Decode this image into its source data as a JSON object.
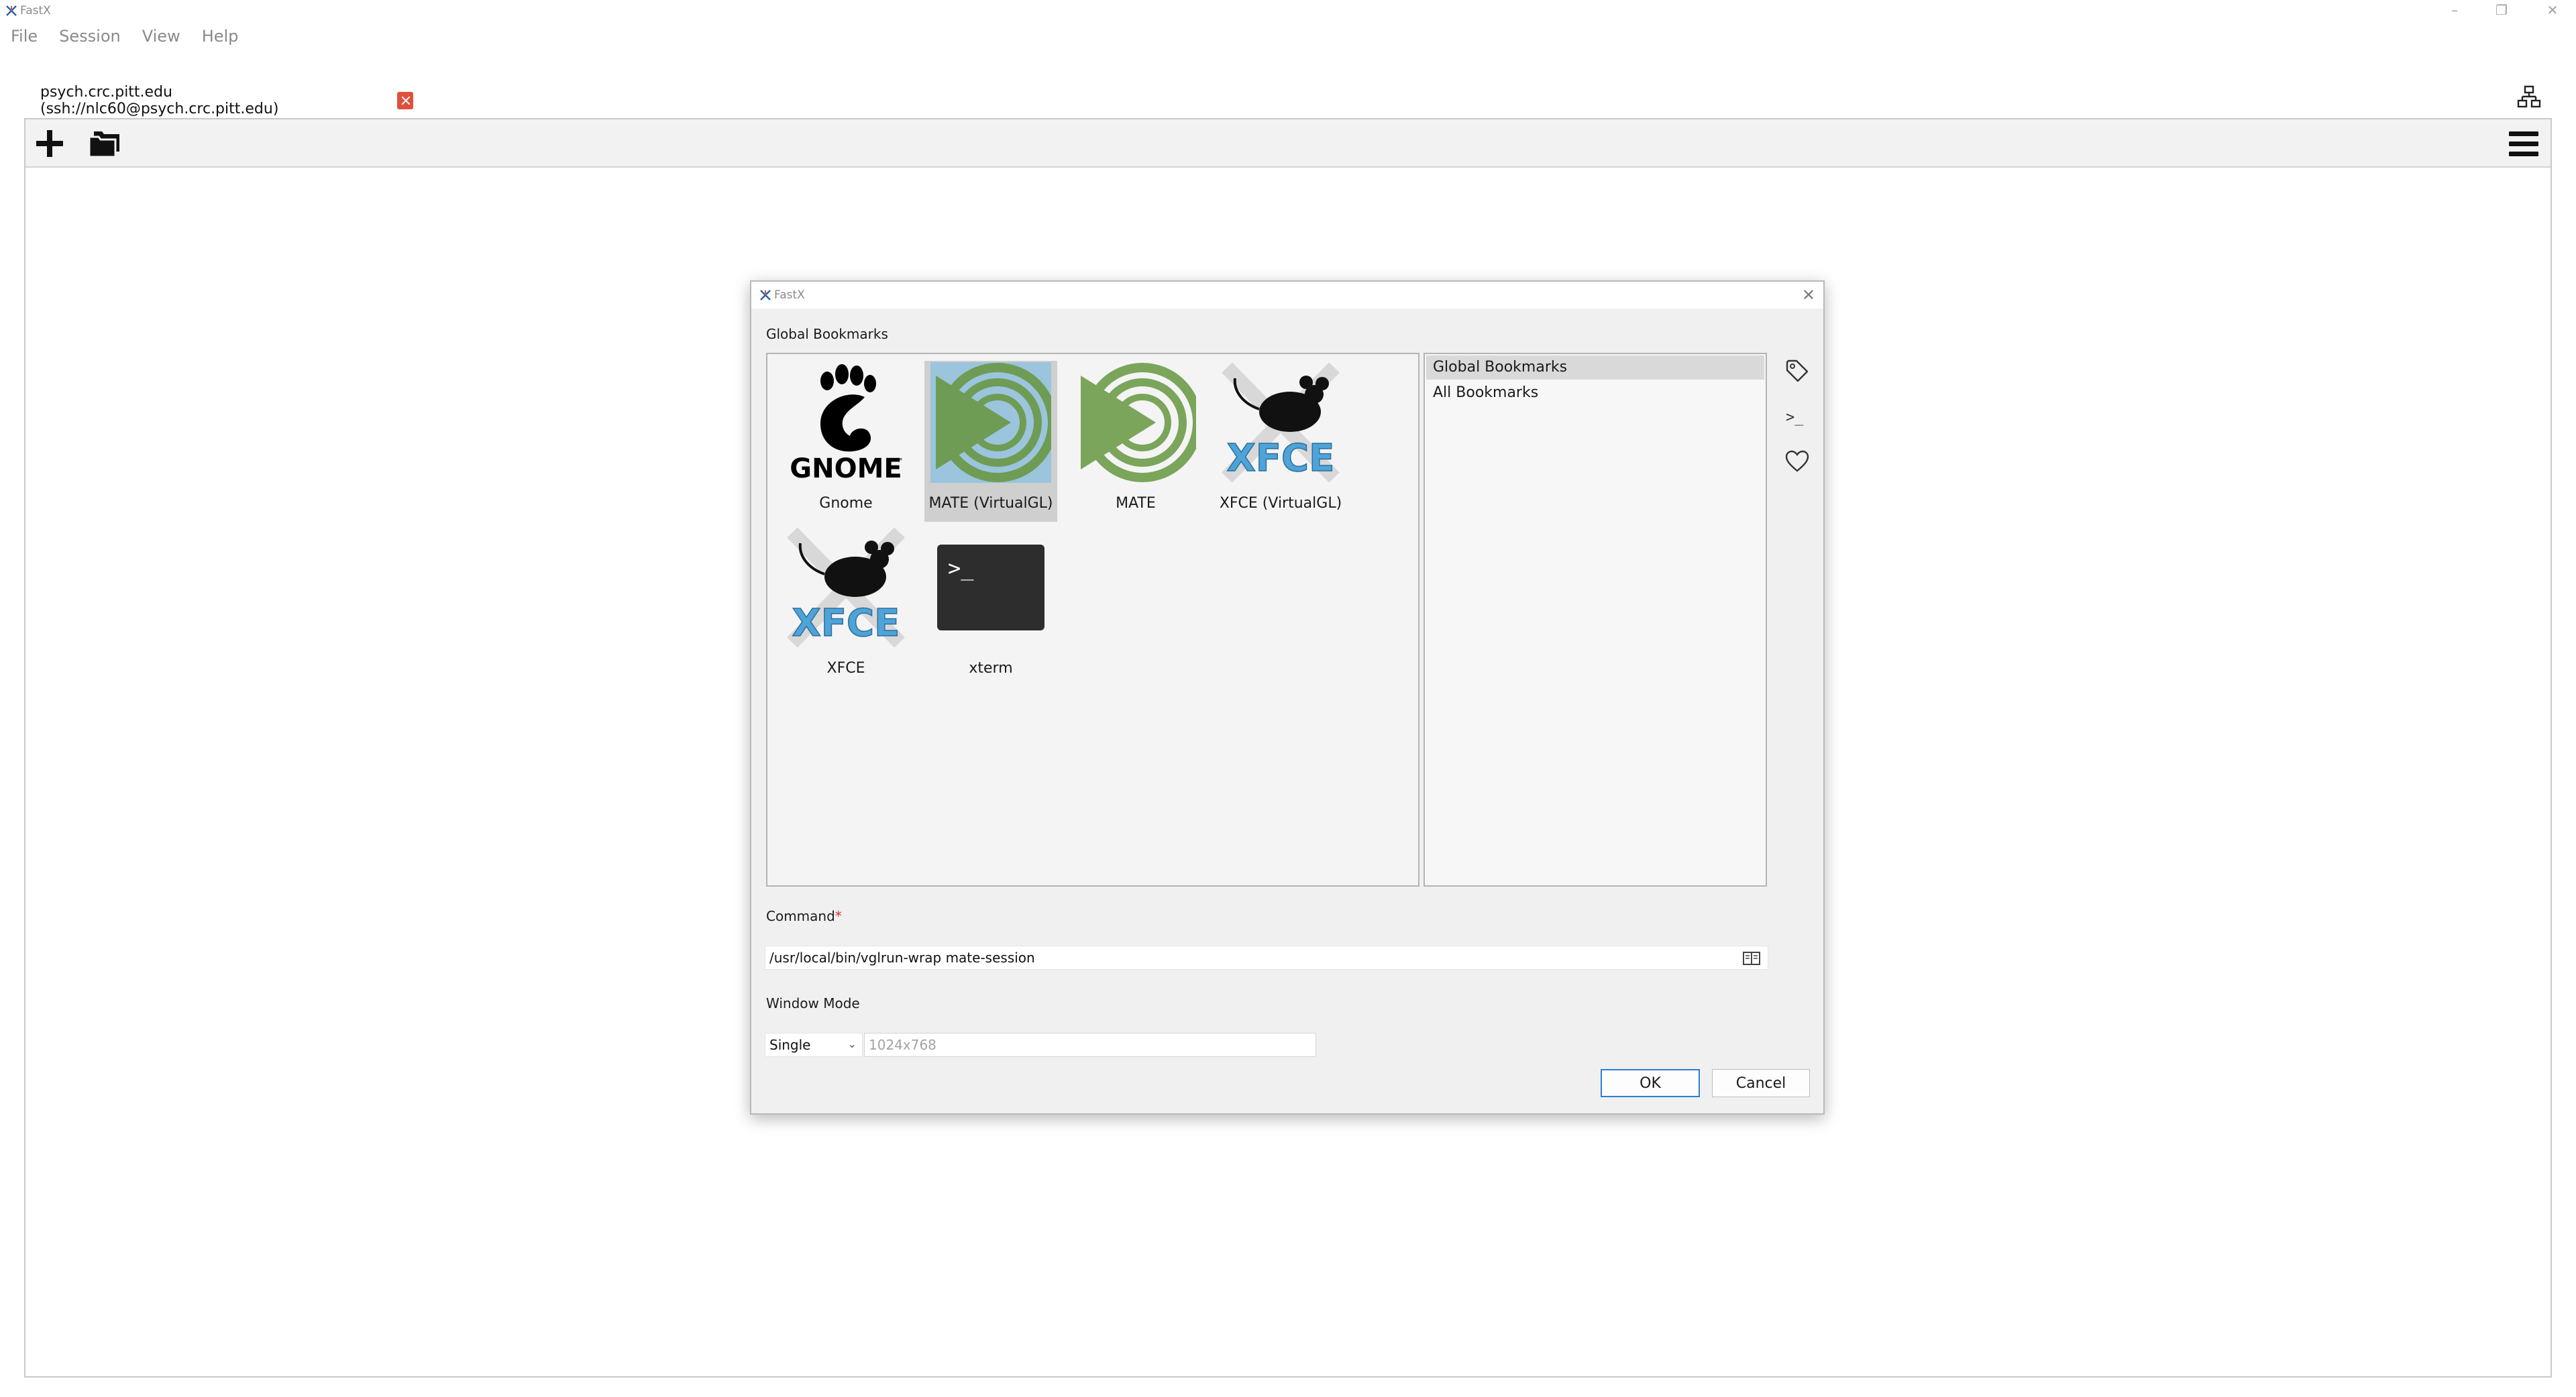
{
  "window": {
    "title": "FastX",
    "minimize_glyph": "–",
    "restore_glyph": "❐",
    "close_glyph": "✕"
  },
  "menu": {
    "items": [
      "File",
      "Session",
      "View",
      "Help"
    ]
  },
  "connection_tab": {
    "label": "psych.crc.pitt.edu (ssh://nlc60@psych.crc.pitt.edu)",
    "close_color": "#e0513b"
  },
  "toolbar": {
    "icons": [
      "plus-icon",
      "folders-icon",
      "hamburger-menu-icon",
      "network-icon"
    ]
  },
  "dialog": {
    "title": "FastX",
    "close_glyph": "✕",
    "bookmarks_heading": "Global Bookmarks",
    "tiles": [
      {
        "label": "Gnome",
        "icon": "gnome-logo-icon",
        "logo_text": "GNOME",
        "logo_tm": "™",
        "selected": false
      },
      {
        "label": "MATE (VirtualGL)",
        "icon": "mate-logo-icon",
        "selected": true
      },
      {
        "label": "MATE",
        "icon": "mate-logo-icon",
        "selected": false
      },
      {
        "label": "XFCE (VirtualGL)",
        "icon": "xfce-logo-icon",
        "logo_text": "XFCE",
        "selected": false
      },
      {
        "label": "XFCE",
        "icon": "xfce-logo-icon",
        "logo_text": "XFCE",
        "selected": false
      },
      {
        "label": "xterm",
        "icon": "terminal-icon",
        "prompt": ">_",
        "selected": false
      }
    ],
    "lists": [
      {
        "label": "Global Bookmarks",
        "active": true
      },
      {
        "label": "All Bookmarks",
        "active": false
      }
    ],
    "side_icons": [
      "tag-icon",
      "terminal-prompt-icon",
      "heart-icon"
    ],
    "side_prompt_glyph": ">_",
    "command_label": "Command",
    "command_required_mark": "*",
    "command_value": "/usr/local/bin/vglrun-wrap mate-session",
    "window_mode_label": "Window Mode",
    "window_mode_value": "Single",
    "window_mode_chevron": "⌄",
    "size_placeholder": "1024x768",
    "ok_label": "OK",
    "cancel_label": "Cancel"
  },
  "colors": {
    "accent": "#2f7dd6",
    "selection_tile": "#cfcfcf",
    "mate_green": "#7aa55a",
    "xfce_blue": "#4ea3d8"
  }
}
